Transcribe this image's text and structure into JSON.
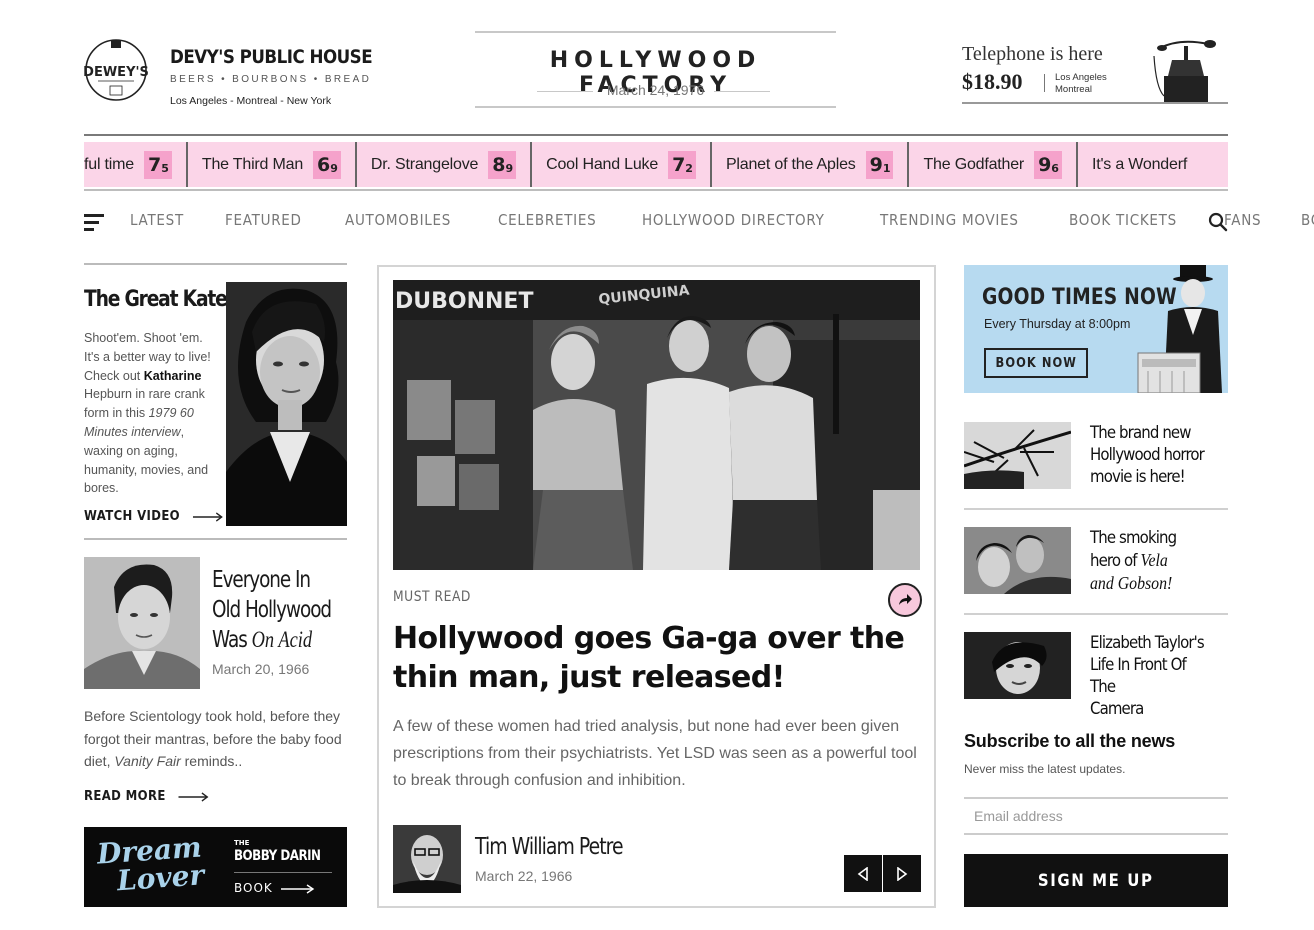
{
  "header": {
    "brand": {
      "name": "DEVY'S PUBLIC HOUSE",
      "tagline": "BEERS • BOURBONS • BREAD",
      "cities": "Los Angeles - Montreal - New York",
      "seal_text": "DEWEY'S"
    },
    "masthead": {
      "title": "HOLLYWOOD FACTORY",
      "date": "March 24, 1976"
    },
    "phone_ad": {
      "title": "Telephone is here",
      "price": "$18.90",
      "city1": "Los Angeles",
      "city2": "Montreal"
    }
  },
  "ticker": [
    {
      "title": "ful time",
      "score_main": "7",
      "score_dec": "5"
    },
    {
      "title": "The Third Man",
      "score_main": "6",
      "score_dec": "9"
    },
    {
      "title": "Dr. Strangelove",
      "score_main": "8",
      "score_dec": "9"
    },
    {
      "title": "Cool Hand Luke",
      "score_main": "7",
      "score_dec": "2"
    },
    {
      "title": "Planet of the Aples",
      "score_main": "9",
      "score_dec": "1"
    },
    {
      "title": "The Godfather",
      "score_main": "9",
      "score_dec": "6"
    },
    {
      "title": "It's a Wonderf",
      "score_main": "",
      "score_dec": ""
    }
  ],
  "nav": {
    "items": [
      "LATEST",
      "FEATURED",
      "AUTOMOBILES",
      "CELEBRETIES",
      "HOLLYWOOD DIRECTORY",
      "TRENDING MOVIES",
      "BOOK TICKETS",
      "FANS",
      "BOOKS"
    ]
  },
  "left": {
    "kate": {
      "title": "The Great Kate",
      "body_pre": "Shoot'em. Shoot 'em. It's a better way to live! Check out ",
      "body_bold1": "Katharine",
      "body_mid": " Hepburn in rare crank form in this ",
      "body_italic": "1979 60 Minutes interview",
      "body_post": ", waxing on aging, humanity, movies, and bores.",
      "link": "WATCH VIDEO"
    },
    "cary": {
      "title_line1": "Everyone In",
      "title_line2": "Old Hollywood",
      "title_line3_pre": "Was ",
      "title_line3_italic": "On Acid",
      "date": "March 20, 1966",
      "body_pre": "Before Scientology took hold, before they forgot their mantras, before the baby food diet, ",
      "body_italic": "Vanity Fair",
      "body_post": " reminds..",
      "link": "READ MORE"
    },
    "dream": {
      "script_line1": "Dream",
      "script_line2": "Lover",
      "small": "THE",
      "artist": "BOBBY DARIN",
      "book": "BOOK"
    }
  },
  "main": {
    "tag": "MUST READ",
    "headline": "Hollywood goes Ga-ga over the thin man, just released!",
    "body": "A few of these women had tried analysis, but none had ever been given prescriptions from their psychiatrists. Yet LSD was seen as a powerful tool to break through confusion and inhibition.",
    "author": "Tim William Petre",
    "author_date": "March 22, 1966",
    "image_signs": [
      "DUBONNET",
      "QUINQUINA"
    ]
  },
  "right": {
    "promo": {
      "title": "GOOD TIMES NOW",
      "sub": "Every Thursday at 8:00pm",
      "button": "BOOK NOW"
    },
    "stories": [
      {
        "line1": "The brand new",
        "line2": "Hollywood horror",
        "line3": "movie is here!",
        "italic": ""
      },
      {
        "line1": "The smoking",
        "line2_pre": "hero of ",
        "line2_italic": "Vela",
        "line3": "and Gobson!"
      },
      {
        "line1": "Elizabeth Taylor's",
        "line2": "Life In Front Of The",
        "line3": "Camera"
      }
    ],
    "subscribe": {
      "title": "Subscribe to all the news",
      "sub": "Never miss the latest updates.",
      "placeholder": "Email address",
      "button": "SIGN ME UP"
    }
  },
  "colors": {
    "ticker_bg": "#fbd5e8",
    "ticker_score": "#f5a2cb",
    "promo_bg": "#b7daf0",
    "share_bg": "#f8c8dc",
    "dream_script": "#a9d2ea"
  },
  "icons": {
    "menu": "hamburger-icon",
    "search": "search-icon",
    "share": "share-icon",
    "prev": "chevron-left-icon",
    "next": "chevron-right-icon",
    "arrow": "arrow-right-icon"
  }
}
